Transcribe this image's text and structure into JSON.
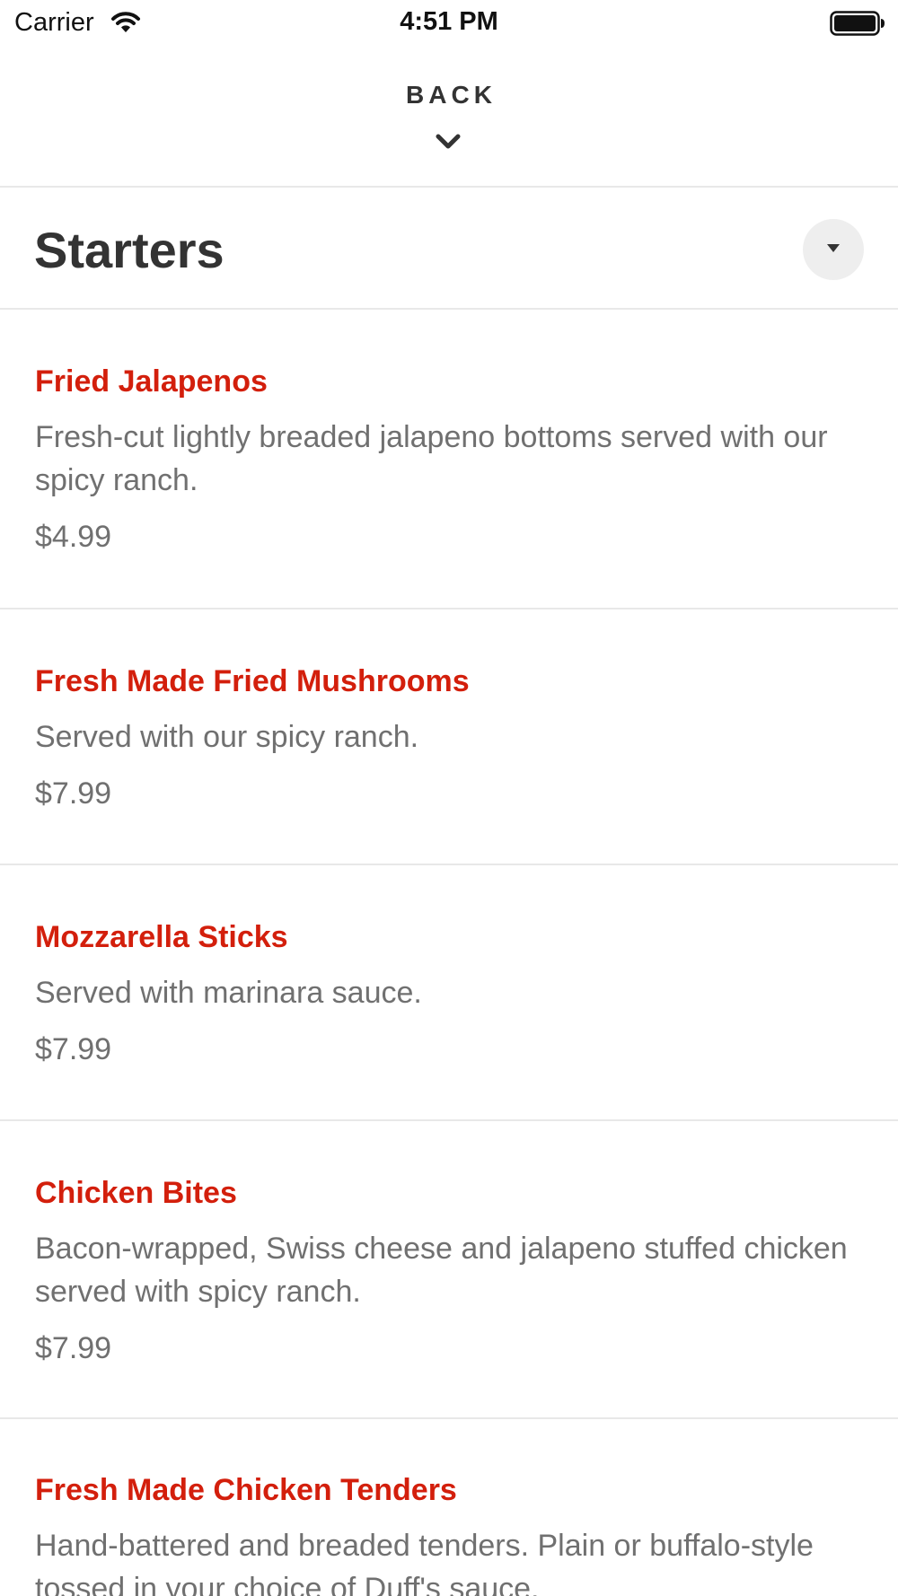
{
  "status_bar": {
    "carrier": "Carrier",
    "time": "4:51 PM"
  },
  "header": {
    "back_label": "BACK"
  },
  "section": {
    "title": "Starters"
  },
  "items": [
    {
      "name": "Fried Jalapenos",
      "description": "Fresh-cut lightly breaded jalapeno bottoms served with our spicy ranch.",
      "price": "$4.99"
    },
    {
      "name": "Fresh Made Fried Mushrooms",
      "description": "Served with our spicy ranch.",
      "price": "$7.99"
    },
    {
      "name": "Mozzarella Sticks",
      "description": "Served with marinara sauce.",
      "price": "$7.99"
    },
    {
      "name": "Chicken Bites",
      "description": "Bacon-wrapped, Swiss cheese and jalapeno stuffed chicken served with spicy ranch.",
      "price": "$7.99"
    },
    {
      "name": "Fresh Made Chicken Tenders",
      "description": "Hand-battered and breaded tenders. Plain or buffalo-style tossed in your choice of Duff's sauce.",
      "price": ""
    }
  ],
  "colors": {
    "item_name": "#d31f0c",
    "text_secondary": "#707070",
    "divider": "#e8e8e8"
  },
  "icons": {
    "wifi": "wifi-icon",
    "battery": "battery-icon",
    "back_chevron": "chevron-down-icon",
    "section_toggle": "caret-down-icon"
  }
}
